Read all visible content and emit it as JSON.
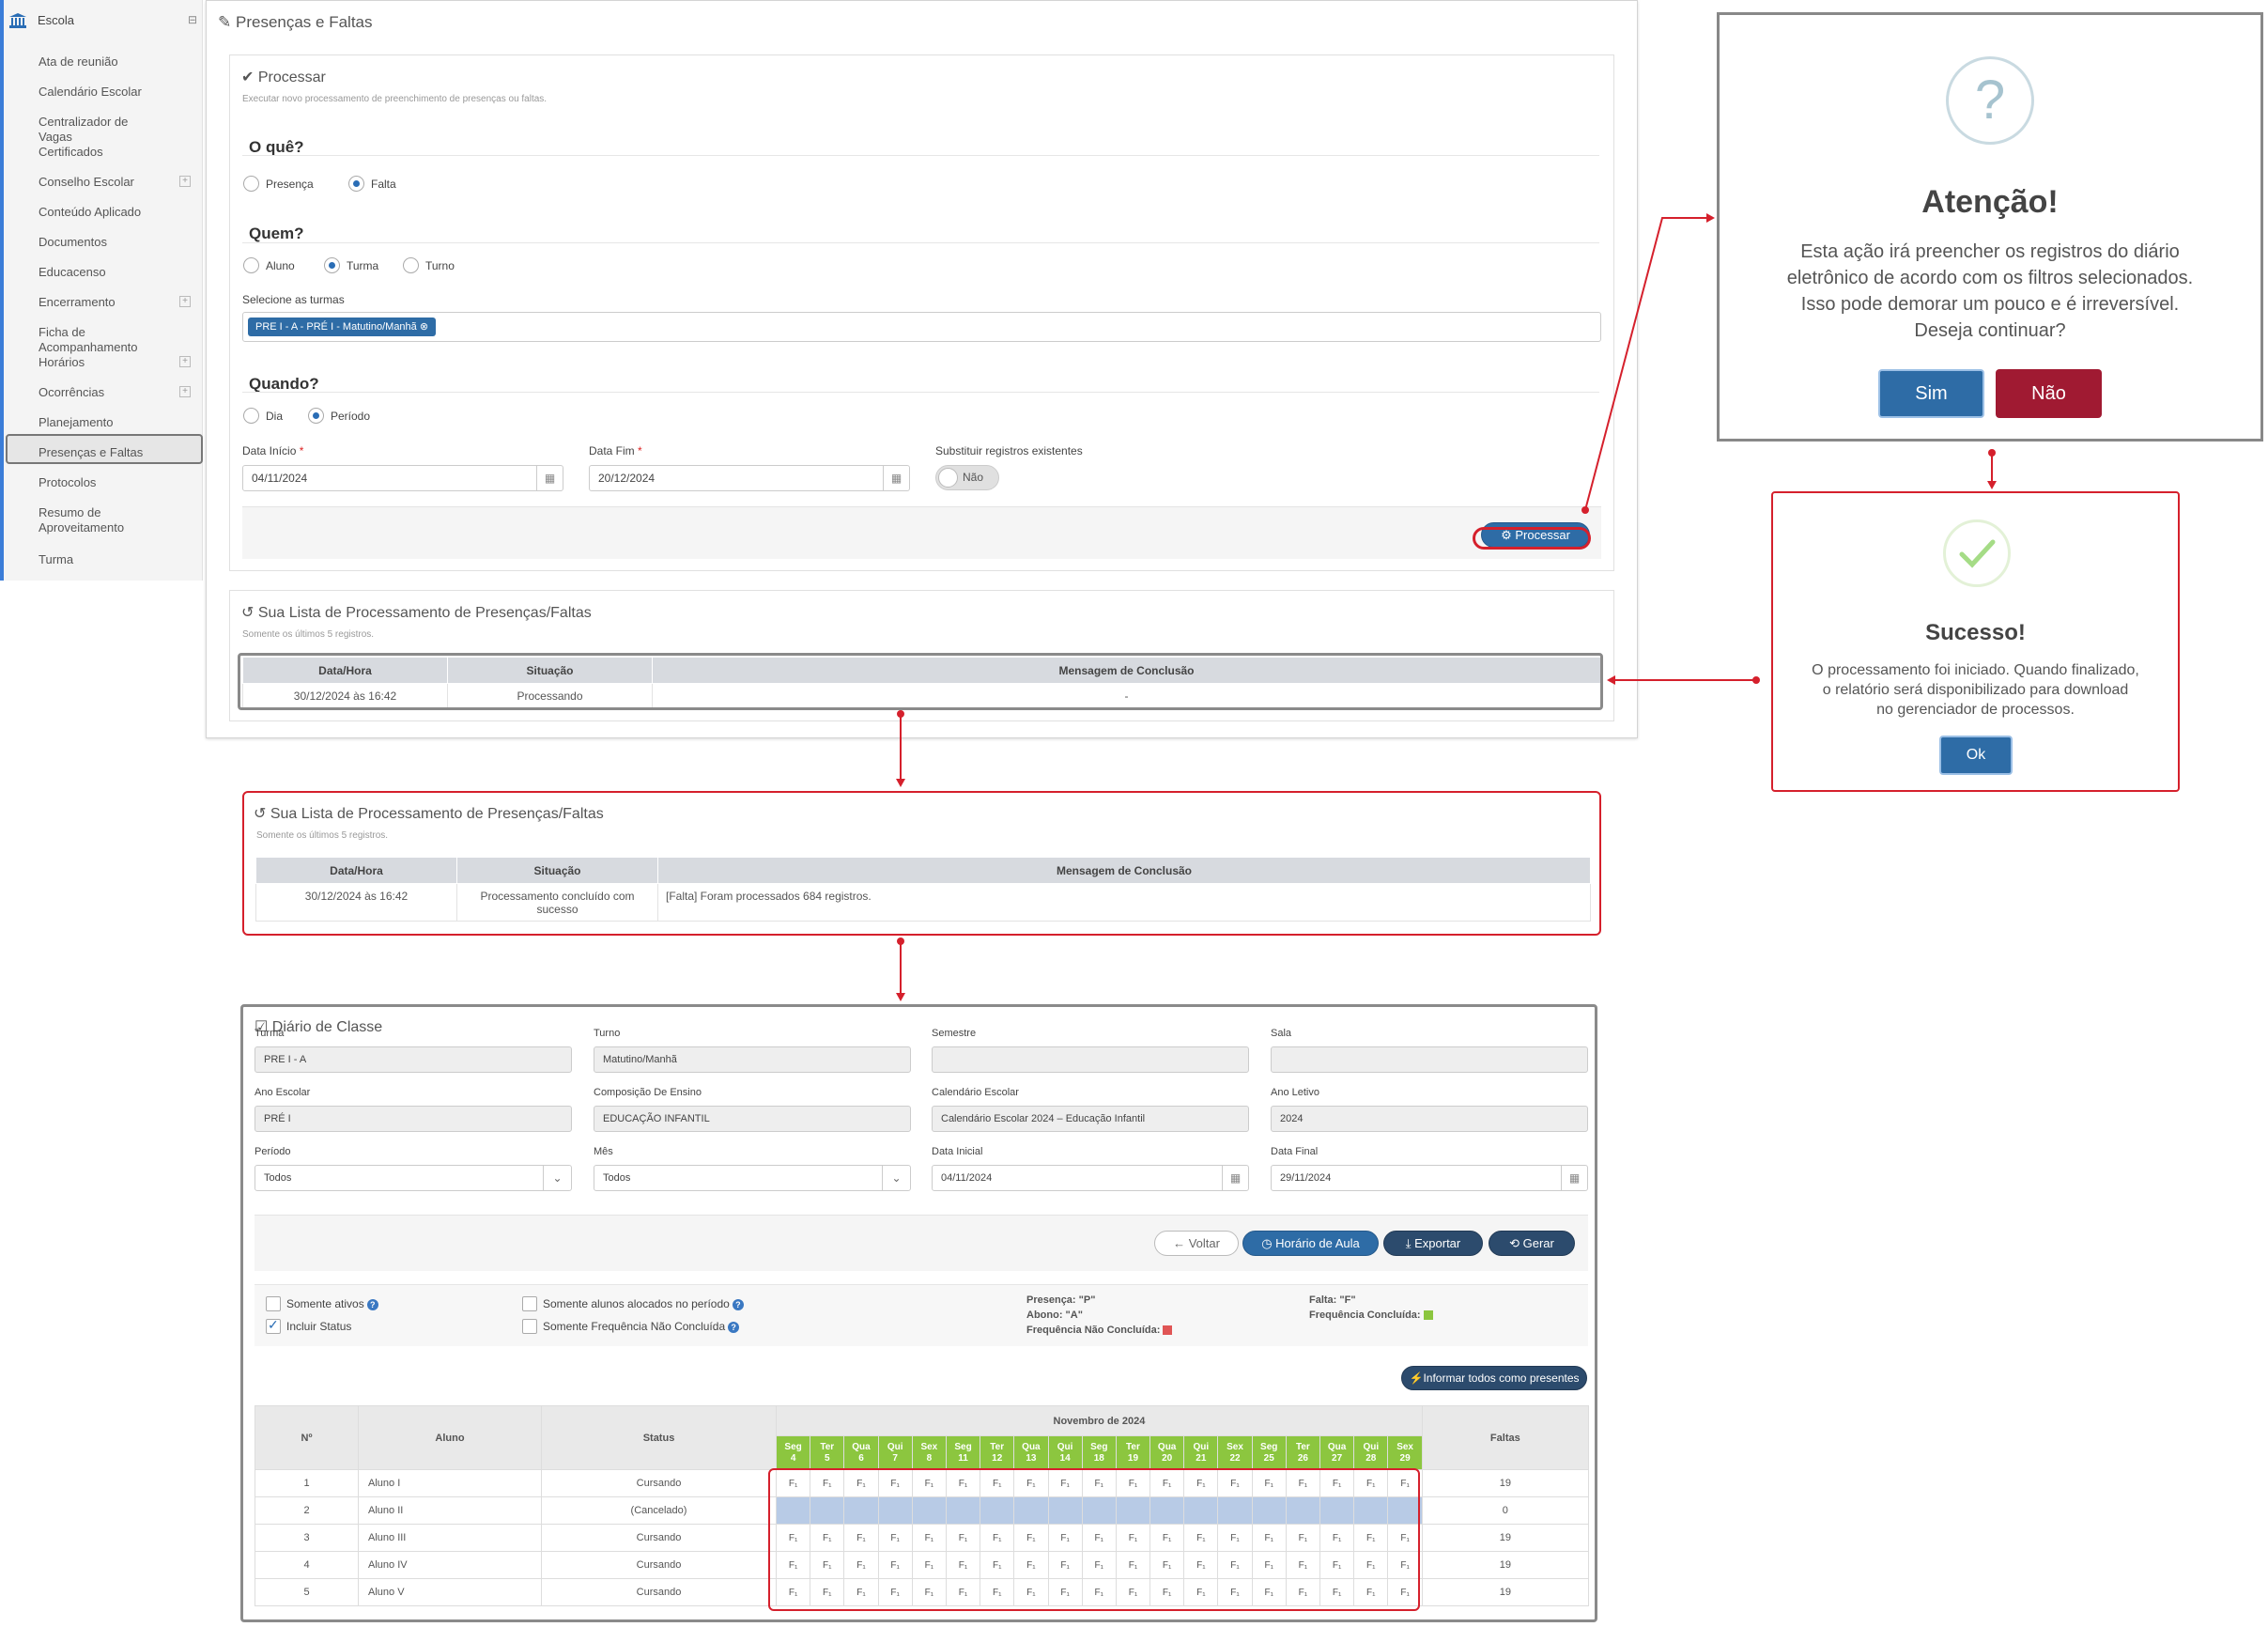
{
  "sidebar": {
    "title": "Escola",
    "items": [
      {
        "label": "Ata de reunião",
        "expand": false
      },
      {
        "label": "Calendário Escolar",
        "expand": false
      },
      {
        "label": "Centralizador de Vagas",
        "expand": false
      },
      {
        "label": "Certificados",
        "expand": false
      },
      {
        "label": "Conselho Escolar",
        "expand": true
      },
      {
        "label": "Conteúdo Aplicado",
        "expand": false
      },
      {
        "label": "Documentos",
        "expand": false
      },
      {
        "label": "Educacenso",
        "expand": false
      },
      {
        "label": "Encerramento",
        "expand": true
      },
      {
        "label": "Ficha de Acompanhamento",
        "expand": false
      },
      {
        "label": "Horários",
        "expand": true
      },
      {
        "label": "Ocorrências",
        "expand": true
      },
      {
        "label": "Planejamento",
        "expand": false
      },
      {
        "label": "Presenças e Faltas",
        "expand": false,
        "active": true
      },
      {
        "label": "Protocolos",
        "expand": false
      },
      {
        "label": "Resumo de Aproveitamento",
        "expand": false
      },
      {
        "label": "Turma",
        "expand": false
      }
    ]
  },
  "page": {
    "title": "Presenças e Faltas"
  },
  "process": {
    "title": "Processar",
    "subtitle": "Executar novo processamento de preenchimento de presenças ou faltas.",
    "what": {
      "heading": "O quê?",
      "options": [
        "Presença",
        "Falta"
      ],
      "selected": "Falta"
    },
    "who": {
      "heading": "Quem?",
      "options": [
        "Aluno",
        "Turma",
        "Turno"
      ],
      "selected": "Turma"
    },
    "turmas_label": "Selecione as turmas",
    "turma_tag": "PRE I - A - PRÉ I - Matutino/Manhã",
    "when": {
      "heading": "Quando?",
      "options": [
        "Dia",
        "Período"
      ],
      "selected": "Período"
    },
    "start_label": "Data Início",
    "start_value": "04/11/2024",
    "end_label": "Data Fim",
    "end_value": "20/12/2024",
    "replace_label": "Substituir registros existentes",
    "replace_value": "Não",
    "button": "Processar"
  },
  "list": {
    "title": "Sua Lista de Processamento de Presenças/Faltas",
    "subtitle": "Somente os últimos 5 registros.",
    "columns": [
      "Data/Hora",
      "Situação",
      "Mensagem de Conclusão"
    ],
    "row": [
      "30/12/2024 às 16:42",
      "Processando",
      "-"
    ]
  },
  "list_done": {
    "title": "Sua Lista de Processamento de Presenças/Faltas",
    "subtitle": "Somente os últimos 5 registros.",
    "columns": [
      "Data/Hora",
      "Situação",
      "Mensagem de Conclusão"
    ],
    "row": [
      "30/12/2024 às 16:42",
      "Processamento concluído com sucesso",
      "[Falta] Foram processados 684 registros."
    ]
  },
  "confirm_dialog": {
    "icon": "?",
    "title": "Atenção!",
    "lines": [
      "Esta ação irá preencher os registros do diário",
      "eletrônico de acordo com os filtros selecionados.",
      "Isso pode demorar um pouco e é irreversível.",
      "Deseja continuar?"
    ],
    "yes": "Sim",
    "no": "Não"
  },
  "success_dialog": {
    "title": "Sucesso!",
    "lines": [
      "O processamento foi iniciado. Quando finalizado,",
      "o relatório será disponibilizado para download",
      "no gerenciador de processos."
    ],
    "ok": "Ok"
  },
  "diary": {
    "title": "Diário de Classe",
    "fields": {
      "turma": {
        "label": "Turma",
        "value": "PRE I - A"
      },
      "turno": {
        "label": "Turno",
        "value": "Matutino/Manhã"
      },
      "semestre": {
        "label": "Semestre",
        "value": ""
      },
      "sala": {
        "label": "Sala",
        "value": ""
      },
      "ano_escolar": {
        "label": "Ano Escolar",
        "value": "PRÉ I"
      },
      "composicao": {
        "label": "Composição De Ensino",
        "value": "EDUCAÇÃO INFANTIL"
      },
      "calendario": {
        "label": "Calendário Escolar",
        "value": "Calendário Escolar 2024 – Educação Infantil"
      },
      "ano_letivo": {
        "label": "Ano Letivo",
        "value": "2024"
      },
      "periodo": {
        "label": "Período",
        "value": "Todos"
      },
      "mes": {
        "label": "Mês",
        "value": "Todos"
      },
      "data_inicial": {
        "label": "Data Inicial",
        "value": "04/11/2024"
      },
      "data_final": {
        "label": "Data Final",
        "value": "29/11/2024"
      }
    },
    "buttons": {
      "voltar": "Voltar",
      "horario": "Horário de Aula",
      "exportar": "Exportar",
      "gerar": "Gerar"
    },
    "filters": {
      "somente_ativos": "Somente ativos",
      "incluir_status": "Incluir Status",
      "somente_alocados": "Somente alunos alocados no período",
      "somente_freq": "Somente Frequência Não Concluída"
    },
    "legend": {
      "presenca": "Presença: \"P\"",
      "abono": "Abono: \"A\"",
      "freq_nao": "Frequência Não Concluída:",
      "falta": "Falta: \"F\"",
      "freq_conc": "Frequência Concluída:",
      "color_nao": "#e05555",
      "color_conc": "#8cc63f"
    },
    "present_all": "Informar todos como presentes",
    "table": {
      "col_n": "Nº",
      "col_aluno": "Aluno",
      "col_status": "Status",
      "col_faltas": "Faltas",
      "month": "Novembro de 2024",
      "days": [
        {
          "wd": "Seg",
          "d": "4"
        },
        {
          "wd": "Ter",
          "d": "5"
        },
        {
          "wd": "Qua",
          "d": "6"
        },
        {
          "wd": "Qui",
          "d": "7"
        },
        {
          "wd": "Sex",
          "d": "8"
        },
        {
          "wd": "Seg",
          "d": "11"
        },
        {
          "wd": "Ter",
          "d": "12"
        },
        {
          "wd": "Qua",
          "d": "13"
        },
        {
          "wd": "Qui",
          "d": "14"
        },
        {
          "wd": "Seg",
          "d": "18"
        },
        {
          "wd": "Ter",
          "d": "19"
        },
        {
          "wd": "Qua",
          "d": "20"
        },
        {
          "wd": "Qui",
          "d": "21"
        },
        {
          "wd": "Sex",
          "d": "22"
        },
        {
          "wd": "Seg",
          "d": "25"
        },
        {
          "wd": "Ter",
          "d": "26"
        },
        {
          "wd": "Qua",
          "d": "27"
        },
        {
          "wd": "Qui",
          "d": "28"
        },
        {
          "wd": "Sex",
          "d": "29"
        }
      ],
      "mark": "F₁",
      "rows": [
        {
          "n": "1",
          "aluno": "Aluno I",
          "status": "Cursando",
          "faltas": "19",
          "filled": true
        },
        {
          "n": "2",
          "aluno": "Aluno II",
          "status": "(Cancelado)",
          "faltas": "0",
          "filled": false
        },
        {
          "n": "3",
          "aluno": "Aluno III",
          "status": "Cursando",
          "faltas": "19",
          "filled": true
        },
        {
          "n": "4",
          "aluno": "Aluno IV",
          "status": "Cursando",
          "faltas": "19",
          "filled": true
        },
        {
          "n": "5",
          "aluno": "Aluno V",
          "status": "Cursando",
          "faltas": "19",
          "filled": true
        }
      ]
    }
  }
}
